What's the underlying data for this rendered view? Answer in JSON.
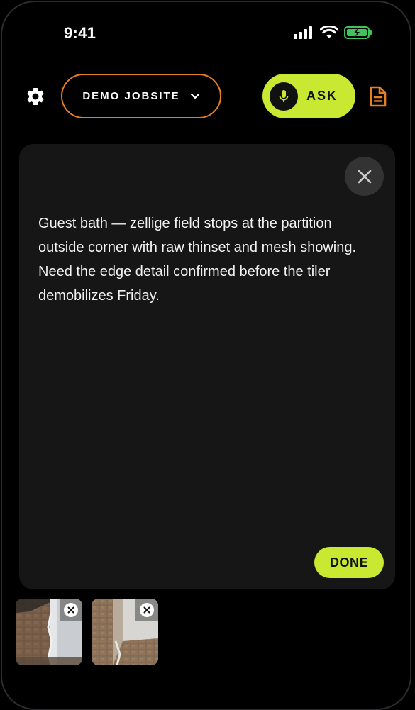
{
  "status_bar": {
    "time": "9:41"
  },
  "header": {
    "jobsite_label": "DEMO JOBSITE",
    "ask_label": "ASK"
  },
  "note_panel": {
    "text": "Guest bath — zellige field stops at the partition outside corner with raw thinset and mesh showing. Need the edge detail confirmed before the tiler demobilizes Friday.",
    "done_label": "DONE"
  },
  "attachments": [
    {
      "kind": "photo"
    },
    {
      "kind": "photo"
    }
  ],
  "colors": {
    "accent": "#c8e832",
    "jobsite_border": "#e67e22",
    "panel": "#161616",
    "background": "#000000"
  },
  "icons": [
    "gear-icon",
    "chevron-down-icon",
    "mic-icon",
    "document-icon",
    "close-icon",
    "signal-icon",
    "wifi-icon",
    "battery-icon"
  ]
}
